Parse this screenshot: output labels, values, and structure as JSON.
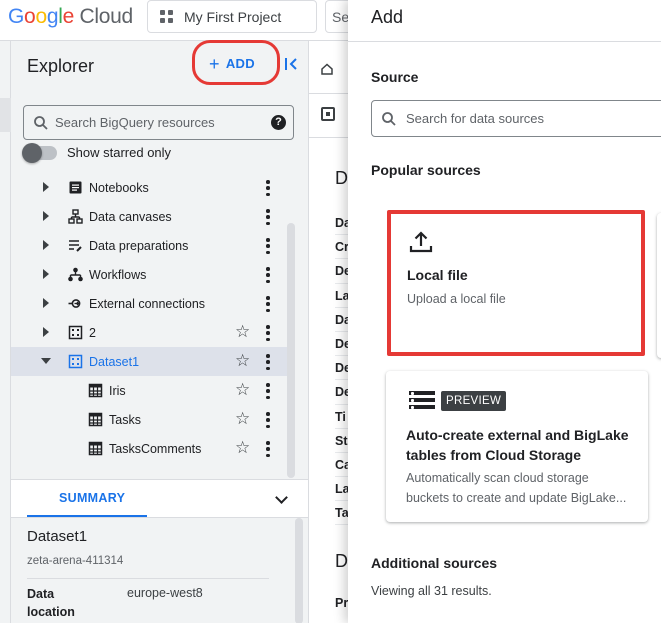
{
  "header": {
    "logo_google": "Google",
    "logo_cloud": "Cloud",
    "project_label": "My First Project",
    "search_stub": "Se"
  },
  "explorer": {
    "title": "Explorer",
    "add_label": "ADD",
    "search_placeholder": "Search BigQuery resources",
    "starred_label": "Show starred only",
    "items": [
      {
        "label": "Notebooks",
        "icon": "notebook-icon",
        "expanded": false
      },
      {
        "label": "Data canvases",
        "icon": "canvas-icon",
        "expanded": false
      },
      {
        "label": "Data preparations",
        "icon": "preparation-icon",
        "expanded": false
      },
      {
        "label": "Workflows",
        "icon": "workflow-icon",
        "expanded": false
      },
      {
        "label": "External connections",
        "icon": "connection-icon",
        "expanded": false
      },
      {
        "label": "2",
        "icon": "dataset-icon",
        "expanded": false,
        "starred": false
      },
      {
        "label": "Dataset1",
        "icon": "dataset-icon",
        "expanded": true,
        "selected": true,
        "starred": false
      },
      {
        "label": "Iris",
        "icon": "table-icon",
        "child": true,
        "starred": false
      },
      {
        "label": "Tasks",
        "icon": "table-icon",
        "child": true,
        "starred": false
      },
      {
        "label": "TasksComments",
        "icon": "table-icon",
        "child": true,
        "starred": false
      }
    ]
  },
  "summary": {
    "tab_label": "SUMMARY",
    "dataset_name": "Dataset1",
    "project_id": "zeta-arena-411314",
    "data_location_key": "Data location",
    "data_location_value": "europe-west8"
  },
  "middle": {
    "heading_initial": "D",
    "field_initials": [
      "Da",
      "Cr",
      "De",
      "La",
      "Da",
      "De",
      "De",
      "De",
      "Ti",
      "St",
      "Ca",
      "La",
      "Ta"
    ],
    "heading2_initial": "D",
    "last_initial": "Pr"
  },
  "drawer": {
    "title": "Add",
    "source_heading": "Source",
    "source_search_placeholder": "Search for data sources",
    "popular_heading": "Popular sources",
    "local_file": {
      "title": "Local file",
      "description": "Upload a local file"
    },
    "biglake": {
      "badge": "PREVIEW",
      "title": "Auto-create external and BigLake tables from Cloud Storage",
      "description_line1": "Automatically scan cloud storage",
      "description_line2": "buckets to create and update BigLake..."
    },
    "additional_heading": "Additional sources",
    "viewing_text": "Viewing all 31 results."
  },
  "colors": {
    "accent": "#1a73e8",
    "highlight_red": "#e53935",
    "panel_bg": "#f1f3f4"
  }
}
